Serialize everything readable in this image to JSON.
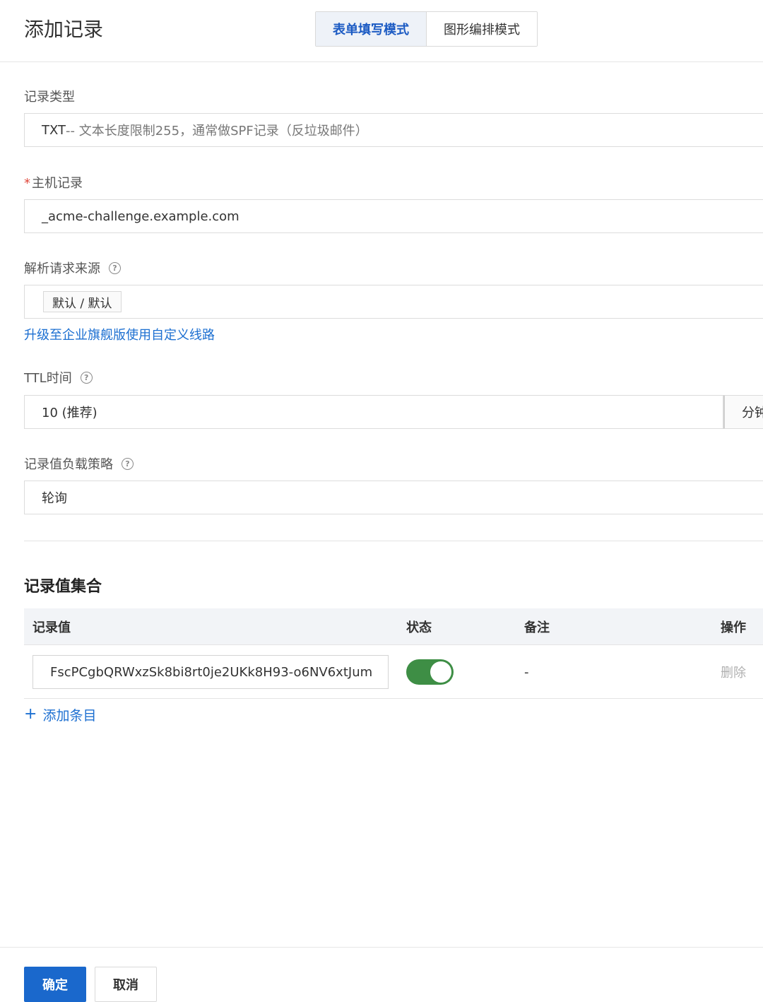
{
  "header": {
    "title": "添加记录",
    "tabs": [
      {
        "label": "表单填写模式",
        "active": true
      },
      {
        "label": "图形编排模式",
        "active": false
      }
    ]
  },
  "form": {
    "record_type": {
      "label": "记录类型",
      "value": "TXT",
      "hint": " -- 文本长度限制255，通常做SPF记录（反垃圾邮件）"
    },
    "host_record": {
      "required_mark": "*",
      "label": "主机记录",
      "value": "_acme-challenge.example.com"
    },
    "resolution_source": {
      "label": "解析请求来源",
      "help_icon": "?",
      "tag": "默认 / 默认",
      "upgrade_link": "升级至企业旗舰版使用自定义线路"
    },
    "ttl": {
      "label": "TTL时间",
      "help_icon": "?",
      "value": "10 (推荐)",
      "unit": "分钟"
    },
    "load_strategy": {
      "label": "记录值负载策略",
      "help_icon": "?",
      "value": "轮询"
    }
  },
  "records": {
    "title": "记录值集合",
    "columns": [
      "记录值",
      "状态",
      "备注",
      "操作"
    ],
    "rows": [
      {
        "value": "FscPCgbQRWxzSk8bi8rt0je2UKk8H93-o6NV6xtJum",
        "enabled": true,
        "note": "-",
        "action": "删除"
      }
    ],
    "add_entry": "添加条目"
  },
  "footer": {
    "confirm": "确定",
    "cancel": "取消"
  },
  "colors": {
    "primary": "#1a68cc",
    "link": "#1c6fd1",
    "toggle_on": "#3e8e45",
    "required": "#e0483c"
  }
}
